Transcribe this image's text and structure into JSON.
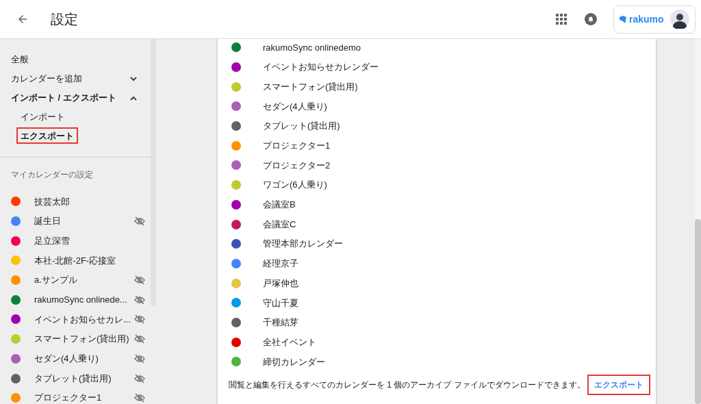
{
  "header": {
    "title": "設定",
    "brand": "rakumo"
  },
  "sidebar": {
    "items": [
      {
        "label": "全般",
        "kind": "link"
      },
      {
        "label": "カレンダーを追加",
        "kind": "group",
        "expanded": false
      },
      {
        "label": "インポート / エクスポート",
        "kind": "group",
        "expanded": true,
        "children": [
          {
            "label": "インポート",
            "selected": false,
            "highlighted": false
          },
          {
            "label": "エクスポート",
            "selected": true,
            "highlighted": true
          }
        ]
      }
    ],
    "section_title": "マイカレンダーの設定",
    "calendars": [
      {
        "name": "技芸太郎",
        "color": "#ff3d00",
        "hidden": false
      },
      {
        "name": "誕生日",
        "color": "#4285f4",
        "hidden": true
      },
      {
        "name": "足立深雪",
        "color": "#f50057",
        "hidden": false
      },
      {
        "name": "本社-北館-2F-応接室",
        "color": "#ffc107",
        "hidden": false
      },
      {
        "name": "a.サンプル",
        "color": "#ff9100",
        "hidden": true
      },
      {
        "name": "rakumoSync onlinede...",
        "color": "#0b8043",
        "hidden": true
      },
      {
        "name": "イベントお知らせカレ...",
        "color": "#a200b0",
        "hidden": true
      },
      {
        "name": "スマートフォン(貸出用)",
        "color": "#c0ca33",
        "hidden": true
      },
      {
        "name": "セダン(4人乗り)",
        "color": "#ad5eb8",
        "hidden": true
      },
      {
        "name": "タブレット(貸出用)",
        "color": "#616161",
        "hidden": true
      },
      {
        "name": "プロジェクター1",
        "color": "#ff9100",
        "hidden": true
      }
    ]
  },
  "export_list": [
    {
      "name": "rakumoSync onlinedemo",
      "color": "#0b8043"
    },
    {
      "name": "イベントお知らせカレンダー",
      "color": "#a200b0"
    },
    {
      "name": "スマートフォン(貸出用)",
      "color": "#c0ca33"
    },
    {
      "name": "セダン(4人乗り)",
      "color": "#ad5eb8"
    },
    {
      "name": "タブレット(貸出用)",
      "color": "#616161"
    },
    {
      "name": "プロジェクター1",
      "color": "#ff9100"
    },
    {
      "name": "プロジェクター2",
      "color": "#ad5eb8"
    },
    {
      "name": "ワゴン(6人乗り)",
      "color": "#c0ca33"
    },
    {
      "name": "会議室B",
      "color": "#a200b0"
    },
    {
      "name": "会議室C",
      "color": "#c2185b"
    },
    {
      "name": "管理本部カレンダー",
      "color": "#3f51b5"
    },
    {
      "name": "経理京子",
      "color": "#4285f4"
    },
    {
      "name": "戸塚伸也",
      "color": "#e4c441"
    },
    {
      "name": "守山千夏",
      "color": "#039be5"
    },
    {
      "name": "千種結芽",
      "color": "#616161"
    },
    {
      "name": "全社イベント",
      "color": "#e50000"
    },
    {
      "name": "締切カレンダー",
      "color": "#4fb43a"
    }
  ],
  "export_footer": {
    "text": "閲覧と編集を行えるすべてのカレンダーを 1 個のアーカイブ ファイルでダウンロードできます。",
    "button": "エクスポート",
    "highlighted": true
  }
}
